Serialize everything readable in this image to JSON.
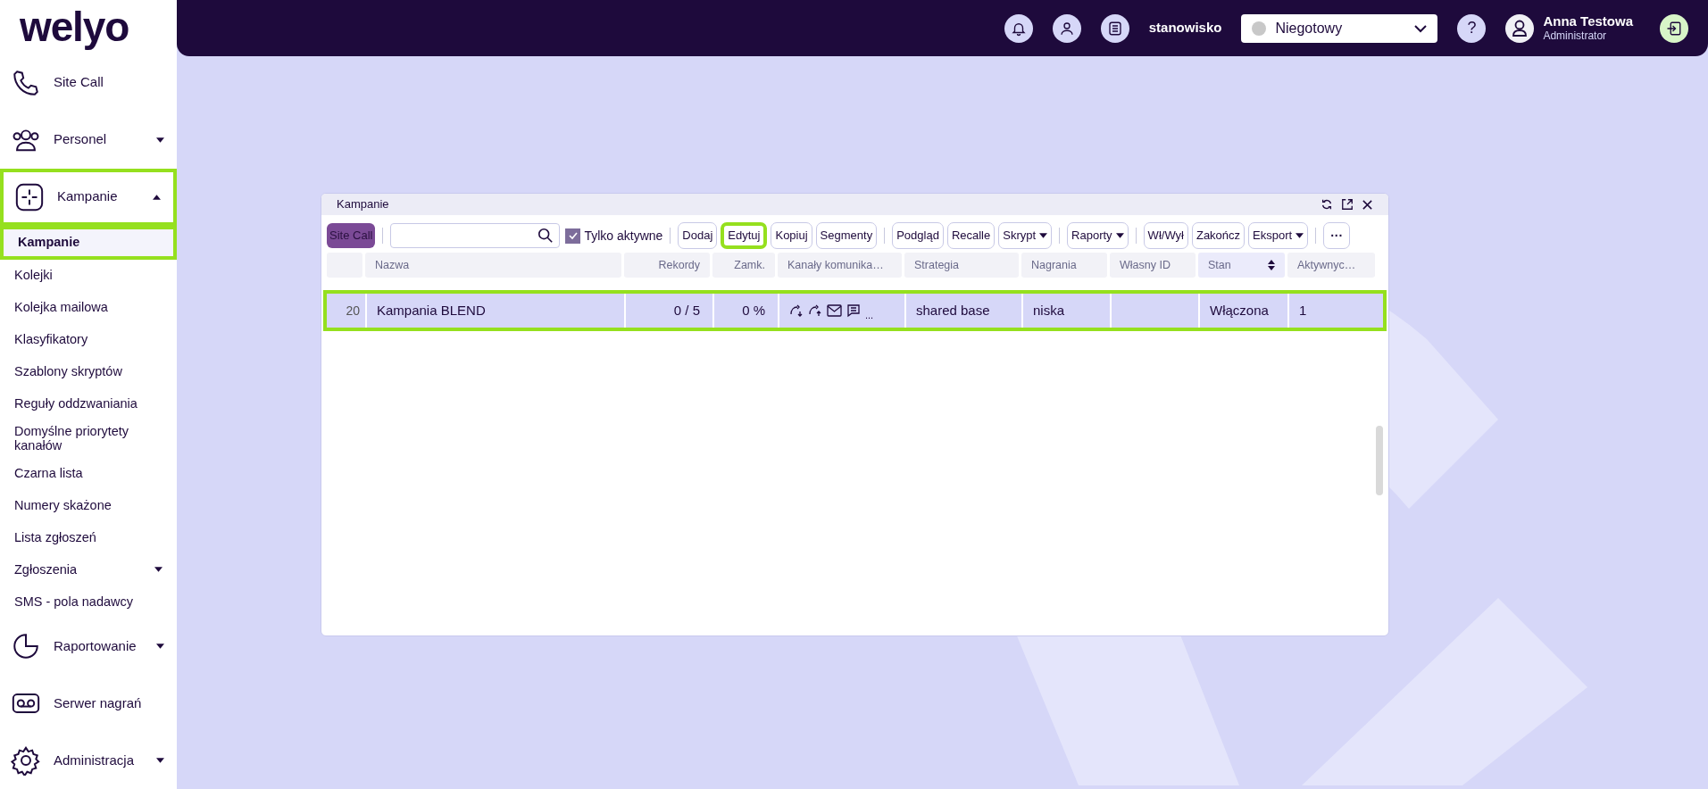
{
  "logo": "welyo",
  "sidebar": {
    "items": [
      {
        "label": "Site Call",
        "selected": false,
        "highlighted": false
      },
      {
        "label": "Personel",
        "expanded": false,
        "selected": false,
        "highlighted": false
      },
      {
        "label": "Kampanie",
        "expanded": true,
        "selected": false,
        "highlighted": true,
        "children": [
          {
            "label": "Kampanie",
            "selected": true,
            "highlighted": true
          },
          {
            "label": "Kolejki",
            "selected": false,
            "highlighted": false
          },
          {
            "label": "Kolejka mailowa",
            "selected": false,
            "highlighted": false
          },
          {
            "label": "Klasyfikatory",
            "selected": false,
            "highlighted": false
          },
          {
            "label": "Szablony skryptów",
            "selected": false,
            "highlighted": false
          },
          {
            "label": "Reguły oddzwaniania",
            "selected": false,
            "highlighted": false
          },
          {
            "label": "Domyślne priorytety kanałów",
            "selected": false,
            "highlighted": false
          },
          {
            "label": "Czarna lista",
            "selected": false,
            "highlighted": false
          },
          {
            "label": "Numery skażone",
            "selected": false,
            "highlighted": false
          },
          {
            "label": "Lista zgłoszeń",
            "selected": false,
            "highlighted": false
          },
          {
            "label": "Zgłoszenia",
            "expanded": false,
            "selected": false,
            "highlighted": false
          },
          {
            "label": "SMS - pola nadawcy",
            "selected": false,
            "highlighted": false
          }
        ]
      },
      {
        "label": "Raportowanie",
        "expanded": false,
        "selected": false,
        "highlighted": false
      },
      {
        "label": "Serwer nagrań",
        "selected": false,
        "highlighted": false
      },
      {
        "label": "Administracja",
        "expanded": false,
        "selected": false,
        "highlighted": false
      }
    ]
  },
  "topbar": {
    "workstation": "stanowisko",
    "status": {
      "value": "Niegotowy",
      "color": "#c8c8c8"
    },
    "help": "?",
    "user": {
      "name": "Anna Testowa",
      "role": "Administrator"
    }
  },
  "window": {
    "title": "Kampanie",
    "toolbar": {
      "site_button": "Site Call",
      "only_active": {
        "label": "Tylko aktywne",
        "checked": true
      },
      "buttons": [
        {
          "label": "Dodaj",
          "dropdown": false,
          "highlighted": false
        },
        {
          "label": "Edytuj",
          "dropdown": false,
          "highlighted": true
        },
        {
          "label": "Kopiuj",
          "dropdown": false,
          "highlighted": false
        },
        {
          "label": "Segmenty",
          "dropdown": false,
          "highlighted": false
        },
        {
          "label": "Podgląd",
          "dropdown": false,
          "highlighted": false
        },
        {
          "label": "Recalle",
          "dropdown": false,
          "highlighted": false
        },
        {
          "label": "Skrypt",
          "dropdown": true,
          "highlighted": false
        },
        {
          "label": "Raporty",
          "dropdown": true,
          "highlighted": false
        },
        {
          "label": "Wł/Wył",
          "dropdown": false,
          "highlighted": false
        },
        {
          "label": "Zakończ",
          "dropdown": false,
          "highlighted": false
        },
        {
          "label": "Eksport",
          "dropdown": true,
          "highlighted": false
        }
      ],
      "more": "···"
    },
    "table": {
      "columns": [
        {
          "label": "Nazwa",
          "sorted": false
        },
        {
          "label": "Rekordy",
          "sorted": false
        },
        {
          "label": "Zamk.",
          "sorted": false
        },
        {
          "label": "Kanały komunika…",
          "sorted": false
        },
        {
          "label": "Strategia",
          "sorted": false
        },
        {
          "label": "Nagrania",
          "sorted": false
        },
        {
          "label": "Własny ID",
          "sorted": false
        },
        {
          "label": "Stan",
          "sorted": true
        },
        {
          "label": "Aktywnyc…",
          "sorted": false
        }
      ],
      "rows": [
        {
          "index": "20",
          "selected": true,
          "highlighted": true,
          "cells": [
            "Kampania BLEND",
            "0 / 5",
            "0 %",
            null,
            "shared base",
            "niska",
            "",
            "Włączona",
            "1"
          ],
          "channels_more": "..."
        }
      ]
    }
  }
}
